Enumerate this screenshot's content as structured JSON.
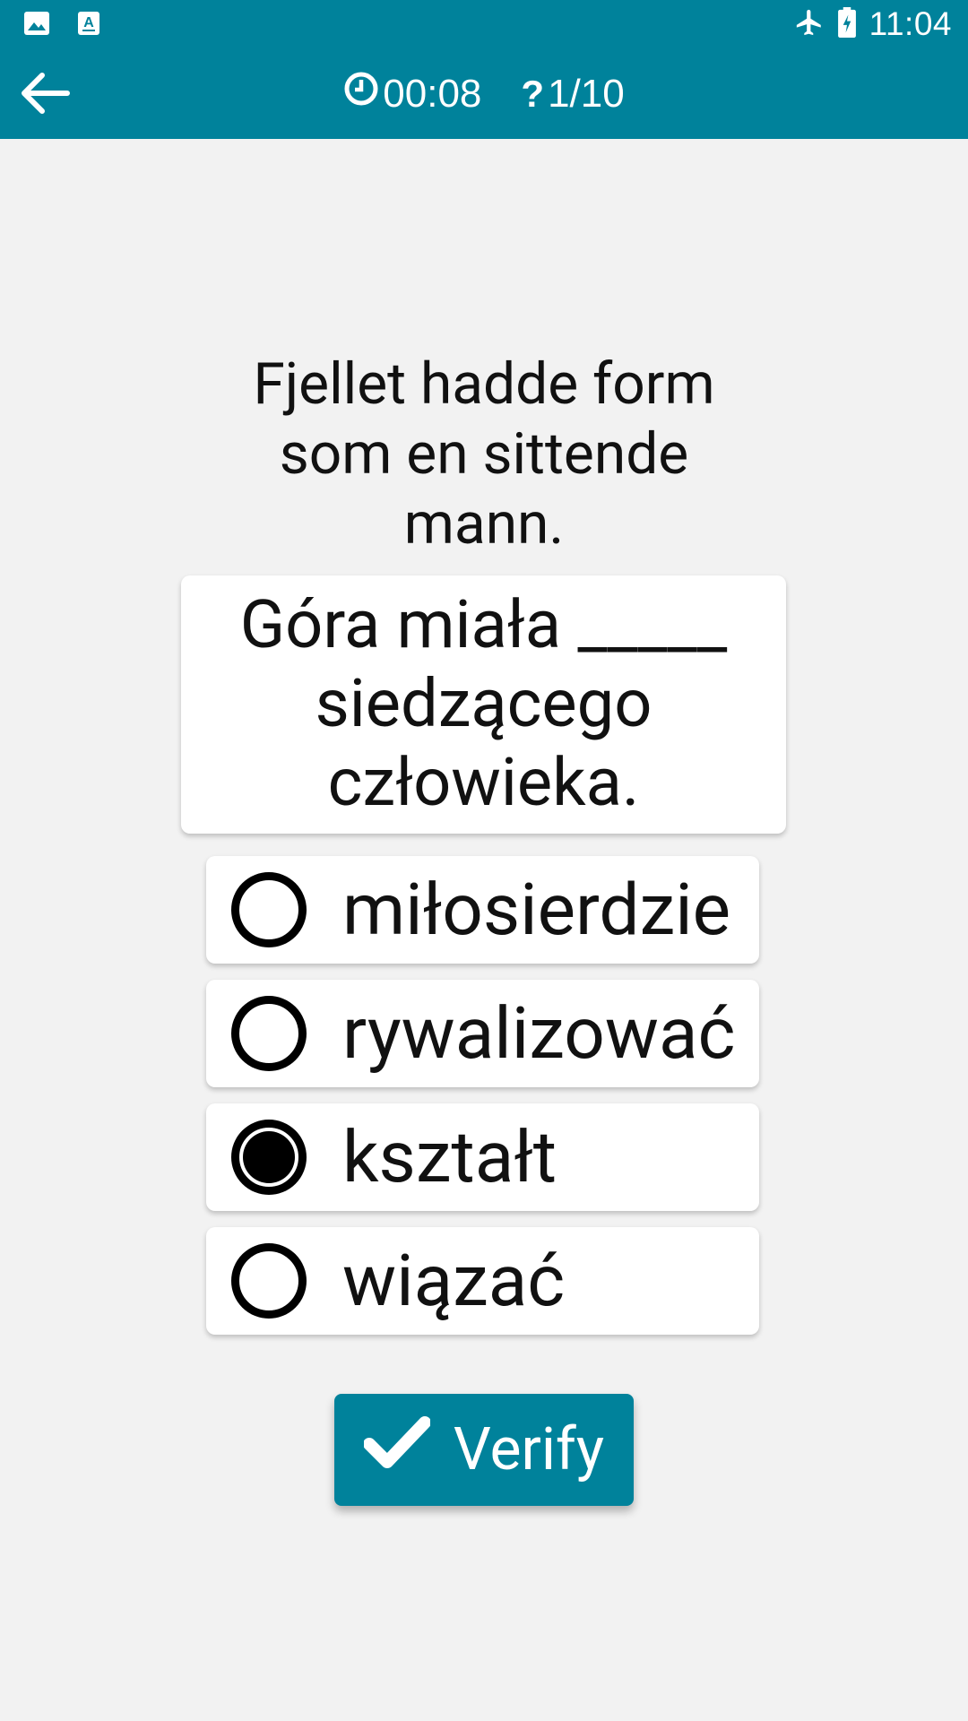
{
  "status_bar": {
    "time": "11:04",
    "icons": [
      "image-icon",
      "keyboard-a-icon",
      "airplane-icon",
      "battery-charging-icon"
    ]
  },
  "app_bar": {
    "timer": "00:08",
    "progress": "1/10",
    "icons": [
      "back-arrow-icon",
      "clock-icon",
      "question-mark-icon"
    ]
  },
  "question": {
    "prompt": "Fjellet hadde form som en sittende mann.",
    "sentence": "Góra miała _____ siedzącego człowieka."
  },
  "options": [
    {
      "label": "miłosierdzie",
      "selected": false
    },
    {
      "label": "rywalizować",
      "selected": false
    },
    {
      "label": "kształt",
      "selected": true
    },
    {
      "label": "wiązać",
      "selected": false
    }
  ],
  "verify": {
    "label": "Verify",
    "icon": "checkmark-icon"
  },
  "colors": {
    "primary": "#00829b",
    "background": "#f2f2f2",
    "card": "#ffffff"
  }
}
